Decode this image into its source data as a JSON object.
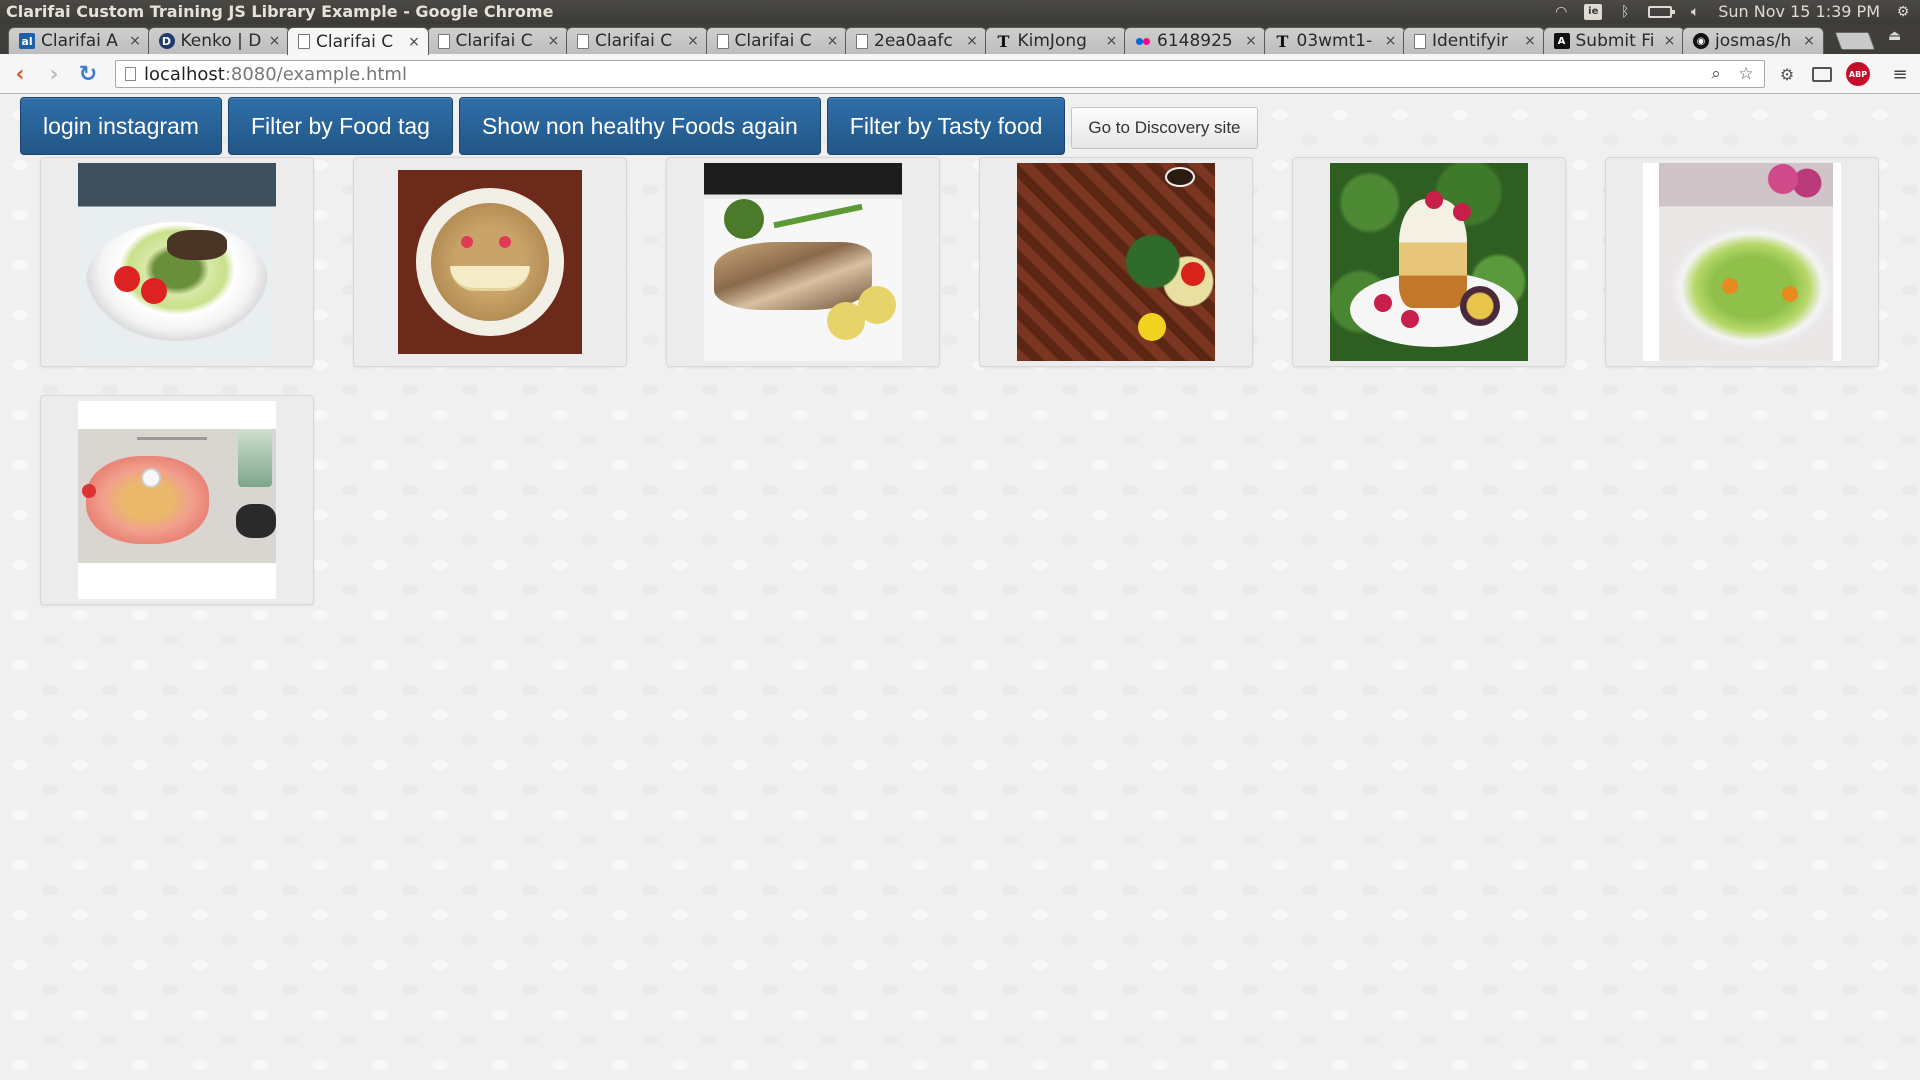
{
  "os": {
    "window_title": "Clarifai Custom Training JS Library Example - Google Chrome",
    "tray_box_text": "ie",
    "clock": "Sun Nov 15  1:39 PM"
  },
  "tabs": [
    {
      "title": "Clarifai A",
      "favicon": "clarifai-icon",
      "active": false
    },
    {
      "title": "Kenko | D",
      "favicon": "d-icon",
      "active": false
    },
    {
      "title": "Clarifai C",
      "favicon": "page-icon",
      "active": true
    },
    {
      "title": "Clarifai C",
      "favicon": "page-icon",
      "active": false
    },
    {
      "title": "Clarifai C",
      "favicon": "page-icon",
      "active": false
    },
    {
      "title": "Clarifai C",
      "favicon": "page-icon",
      "active": false
    },
    {
      "title": "2ea0aafc",
      "favicon": "page-icon",
      "active": false
    },
    {
      "title": "KimJong",
      "favicon": "t-icon",
      "active": false
    },
    {
      "title": "6148925",
      "favicon": "flickr-icon",
      "active": false
    },
    {
      "title": "03wmt1-",
      "favicon": "t-icon",
      "active": false
    },
    {
      "title": "Identifyir",
      "favicon": "page-icon",
      "active": false
    },
    {
      "title": "Submit Fi",
      "favicon": "a-icon",
      "active": false
    },
    {
      "title": "josmas/h",
      "favicon": "github-icon",
      "active": false
    }
  ],
  "toolbar": {
    "url_host": "localhost",
    "url_path": ":8080/example.html",
    "abp_label": "ABP"
  },
  "buttons": {
    "login": "login instagram",
    "filter_food": "Filter by Food tag",
    "show_non_healthy": "Show non healthy Foods again",
    "filter_tasty": "Filter by Tasty food",
    "discovery": "Go to Discovery site"
  },
  "gallery": {
    "images": [
      {
        "subject": "salad-bowl-with-meat"
      },
      {
        "subject": "porridge-smiley-face"
      },
      {
        "subject": "grilled-fish-with-vegetables"
      },
      {
        "subject": "chocolate-platter"
      },
      {
        "subject": "fruit-dessert-parfait"
      },
      {
        "subject": "green-salad-bowl"
      },
      {
        "subject": "plated-dish-with-drink"
      }
    ]
  },
  "colors": {
    "primary_button": "#2a62a0",
    "page_background": "#f0f0f0",
    "abp_red": "#c70d2c"
  }
}
